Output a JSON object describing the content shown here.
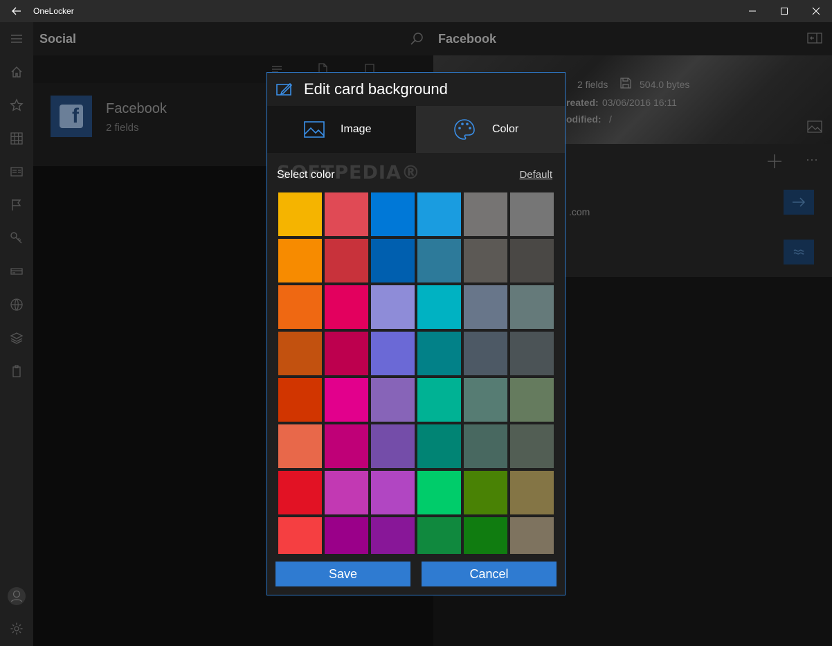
{
  "window": {
    "title": "OneLocker"
  },
  "list": {
    "title": "Social",
    "item": {
      "title": "Facebook",
      "subtitle": "2 fields"
    }
  },
  "detail": {
    "title": "Facebook",
    "fields_count": "2 fields",
    "size": "504.0 bytes",
    "created_label": "reated:",
    "created_value": "03/06/2016 16:11",
    "modified_label": "odified:",
    "modified_value": "/",
    "partial_text": ".com"
  },
  "dialog": {
    "title": "Edit card background",
    "tabs": {
      "image": "Image",
      "color": "Color"
    },
    "select_label": "Select color",
    "watermark": "SOFTPEDIA®",
    "default_link": "Default",
    "save": "Save",
    "cancel": "Cancel",
    "colors": [
      [
        "#f5b400",
        "#e04a55",
        "#0078d7",
        "#1a9ce0",
        "#767473",
        "#767676"
      ],
      [
        "#f78b00",
        "#c8323b",
        "#005faf",
        "#2d7a9a",
        "#5c5955",
        "#4a4845"
      ],
      [
        "#ef6812",
        "#e3005e",
        "#8e8cd8",
        "#00b2c2",
        "#68768a",
        "#657a7a"
      ],
      [
        "#c2510f",
        "#bd004e",
        "#6b69d6",
        "#028188",
        "#4d5965",
        "#4b5356"
      ],
      [
        "#d13500",
        "#e2008c",
        "#8764b8",
        "#00b294",
        "#567c73",
        "#657b5e"
      ],
      [
        "#e8684a",
        "#bf0077",
        "#744da9",
        "#018474",
        "#486860",
        "#525e54"
      ],
      [
        "#e21224",
        "#c239b3",
        "#b146c2",
        "#00cc6a",
        "#498205",
        "#847545"
      ],
      [
        "#f53f41",
        "#9a0089",
        "#881798",
        "#10893e",
        "#107c10",
        "#7e735f"
      ]
    ]
  }
}
